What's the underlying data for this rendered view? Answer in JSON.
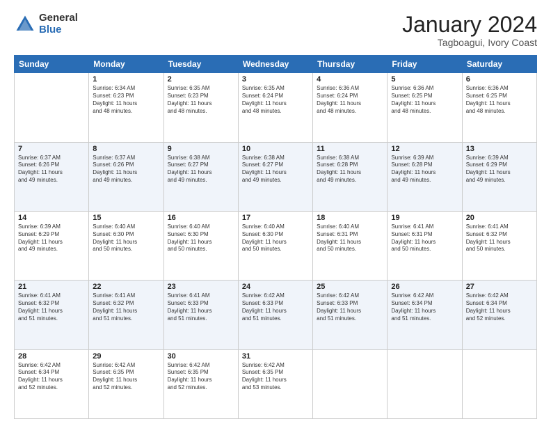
{
  "logo": {
    "general": "General",
    "blue": "Blue"
  },
  "title": "January 2024",
  "location": "Tagboagui, Ivory Coast",
  "weekdays": [
    "Sunday",
    "Monday",
    "Tuesday",
    "Wednesday",
    "Thursday",
    "Friday",
    "Saturday"
  ],
  "weeks": [
    [
      {
        "day": "",
        "text": ""
      },
      {
        "day": "1",
        "text": "Sunrise: 6:34 AM\nSunset: 6:23 PM\nDaylight: 11 hours\nand 48 minutes."
      },
      {
        "day": "2",
        "text": "Sunrise: 6:35 AM\nSunset: 6:23 PM\nDaylight: 11 hours\nand 48 minutes."
      },
      {
        "day": "3",
        "text": "Sunrise: 6:35 AM\nSunset: 6:24 PM\nDaylight: 11 hours\nand 48 minutes."
      },
      {
        "day": "4",
        "text": "Sunrise: 6:36 AM\nSunset: 6:24 PM\nDaylight: 11 hours\nand 48 minutes."
      },
      {
        "day": "5",
        "text": "Sunrise: 6:36 AM\nSunset: 6:25 PM\nDaylight: 11 hours\nand 48 minutes."
      },
      {
        "day": "6",
        "text": "Sunrise: 6:36 AM\nSunset: 6:25 PM\nDaylight: 11 hours\nand 48 minutes."
      }
    ],
    [
      {
        "day": "7",
        "text": "Sunrise: 6:37 AM\nSunset: 6:26 PM\nDaylight: 11 hours\nand 49 minutes."
      },
      {
        "day": "8",
        "text": "Sunrise: 6:37 AM\nSunset: 6:26 PM\nDaylight: 11 hours\nand 49 minutes."
      },
      {
        "day": "9",
        "text": "Sunrise: 6:38 AM\nSunset: 6:27 PM\nDaylight: 11 hours\nand 49 minutes."
      },
      {
        "day": "10",
        "text": "Sunrise: 6:38 AM\nSunset: 6:27 PM\nDaylight: 11 hours\nand 49 minutes."
      },
      {
        "day": "11",
        "text": "Sunrise: 6:38 AM\nSunset: 6:28 PM\nDaylight: 11 hours\nand 49 minutes."
      },
      {
        "day": "12",
        "text": "Sunrise: 6:39 AM\nSunset: 6:28 PM\nDaylight: 11 hours\nand 49 minutes."
      },
      {
        "day": "13",
        "text": "Sunrise: 6:39 AM\nSunset: 6:29 PM\nDaylight: 11 hours\nand 49 minutes."
      }
    ],
    [
      {
        "day": "14",
        "text": "Sunrise: 6:39 AM\nSunset: 6:29 PM\nDaylight: 11 hours\nand 49 minutes."
      },
      {
        "day": "15",
        "text": "Sunrise: 6:40 AM\nSunset: 6:30 PM\nDaylight: 11 hours\nand 50 minutes."
      },
      {
        "day": "16",
        "text": "Sunrise: 6:40 AM\nSunset: 6:30 PM\nDaylight: 11 hours\nand 50 minutes."
      },
      {
        "day": "17",
        "text": "Sunrise: 6:40 AM\nSunset: 6:30 PM\nDaylight: 11 hours\nand 50 minutes."
      },
      {
        "day": "18",
        "text": "Sunrise: 6:40 AM\nSunset: 6:31 PM\nDaylight: 11 hours\nand 50 minutes."
      },
      {
        "day": "19",
        "text": "Sunrise: 6:41 AM\nSunset: 6:31 PM\nDaylight: 11 hours\nand 50 minutes."
      },
      {
        "day": "20",
        "text": "Sunrise: 6:41 AM\nSunset: 6:32 PM\nDaylight: 11 hours\nand 50 minutes."
      }
    ],
    [
      {
        "day": "21",
        "text": "Sunrise: 6:41 AM\nSunset: 6:32 PM\nDaylight: 11 hours\nand 51 minutes."
      },
      {
        "day": "22",
        "text": "Sunrise: 6:41 AM\nSunset: 6:32 PM\nDaylight: 11 hours\nand 51 minutes."
      },
      {
        "day": "23",
        "text": "Sunrise: 6:41 AM\nSunset: 6:33 PM\nDaylight: 11 hours\nand 51 minutes."
      },
      {
        "day": "24",
        "text": "Sunrise: 6:42 AM\nSunset: 6:33 PM\nDaylight: 11 hours\nand 51 minutes."
      },
      {
        "day": "25",
        "text": "Sunrise: 6:42 AM\nSunset: 6:33 PM\nDaylight: 11 hours\nand 51 minutes."
      },
      {
        "day": "26",
        "text": "Sunrise: 6:42 AM\nSunset: 6:34 PM\nDaylight: 11 hours\nand 51 minutes."
      },
      {
        "day": "27",
        "text": "Sunrise: 6:42 AM\nSunset: 6:34 PM\nDaylight: 11 hours\nand 52 minutes."
      }
    ],
    [
      {
        "day": "28",
        "text": "Sunrise: 6:42 AM\nSunset: 6:34 PM\nDaylight: 11 hours\nand 52 minutes."
      },
      {
        "day": "29",
        "text": "Sunrise: 6:42 AM\nSunset: 6:35 PM\nDaylight: 11 hours\nand 52 minutes."
      },
      {
        "day": "30",
        "text": "Sunrise: 6:42 AM\nSunset: 6:35 PM\nDaylight: 11 hours\nand 52 minutes."
      },
      {
        "day": "31",
        "text": "Sunrise: 6:42 AM\nSunset: 6:35 PM\nDaylight: 11 hours\nand 53 minutes."
      },
      {
        "day": "",
        "text": ""
      },
      {
        "day": "",
        "text": ""
      },
      {
        "day": "",
        "text": ""
      }
    ]
  ]
}
